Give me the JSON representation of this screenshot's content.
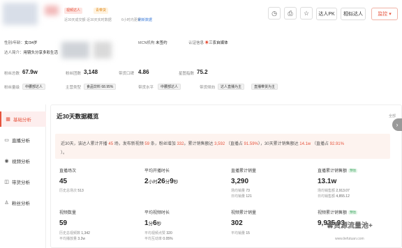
{
  "header": {
    "badge_primary": "视频达人",
    "badge_secondary": "青带货",
    "sub_left": "近30天成交额·近30天实时数据",
    "sub_time": "6小时内更新",
    "sub_link": "刷新数据",
    "pk_label": "达人PK",
    "similar_label": "相似达人",
    "monitor_label": "监控"
  },
  "profile": {
    "gender_label": "性别/年龄：",
    "gender_value": "女/34岁",
    "intro_label": "达人简介：",
    "intro_value": "用镜头分享多彩生活",
    "mcn_label": "MCN机构",
    "mcn_value": "未签约",
    "cert_label": "认证信息",
    "cert_value": "三农自媒体"
  },
  "stats": [
    {
      "label": "粉丝总数",
      "value": "67.9w"
    },
    {
      "label": "粉丝团数",
      "value": "3,148"
    },
    {
      "label": "带货口碑",
      "value": "4.86"
    },
    {
      "label": "星图指数",
      "value": "75.2"
    }
  ],
  "row_tags": {
    "fans_level_label": "粉丝量级",
    "fans_level": "中腰部达人",
    "cat_label": "主营类型",
    "cat_value": "食品饮料",
    "cat_pct": "68.95%",
    "sell_level_label": "带货水平",
    "sell_level": "中腰部达人",
    "method_label": "带货倾向",
    "method_1": "达人直播为主",
    "method_2": "直播带货为主"
  },
  "sidebar": {
    "items": [
      {
        "label": "基础分析",
        "icon": "grid-icon"
      },
      {
        "label": "直播分析",
        "icon": "tv-icon"
      },
      {
        "label": "视频分析",
        "icon": "play-icon"
      },
      {
        "label": "带货分析",
        "icon": "cart-icon"
      },
      {
        "label": "粉丝分析",
        "icon": "user-icon"
      }
    ]
  },
  "overview": {
    "title": "近30天数据概览",
    "more": "全部",
    "summary": {
      "p1": "近30天，该达人累计开播",
      "n_live": "45",
      "p2": "场，发布新视频",
      "n_video": "59",
      "p3": "条，粉丝增加",
      "n_fans": "332",
      "p4": "。累计销售额达",
      "n_sales": "3,592",
      "p5": "（直播占",
      "pct_live": "91.59%",
      "p6": "），30天累计销售额达",
      "n_total": "14.1w",
      "p7": "（直播占",
      "pct_total": "92.91%",
      "p8": "）。"
    },
    "metrics": [
      {
        "label": "直播场次",
        "value": "45",
        "subs": [
          {
            "k": "历史总场次",
            "v": "513"
          }
        ]
      },
      {
        "label": "平均开播时长",
        "value_h": "2",
        "unit_h": "小时",
        "value_m": "26",
        "unit_m": "分",
        "value_s": "9",
        "unit_s": "秒"
      },
      {
        "label": "直播累计销量",
        "value": "3,290",
        "subs": [
          {
            "k": "场均销量",
            "v": "73"
          },
          {
            "k": "日均销量",
            "v": "121"
          }
        ]
      },
      {
        "label": "直播累计销售额",
        "badge": "预估",
        "value": "13.1w",
        "subs": [
          {
            "k": "场均销售额",
            "v": "2,913.07"
          },
          {
            "k": "日均销售额",
            "v": "4,855.12"
          }
        ]
      },
      {
        "label": "视频数量",
        "value": "59",
        "subs": [
          {
            "k": "历史总视频数",
            "v": "1,342"
          },
          {
            "k": "平均播放量",
            "v": "3.2w"
          }
        ]
      },
      {
        "label": "平均视频时长",
        "value_m": "1",
        "unit_m": "分",
        "value_s": "6",
        "unit_s": "秒",
        "subs": [
          {
            "k": "平均视频点赞",
            "v": "320"
          },
          {
            "k": "平均互动率",
            "v": "0.05%"
          }
        ]
      },
      {
        "label": "视频累计销量",
        "value": "302",
        "subs": [
          {
            "k": "平均销量",
            "v": "15"
          }
        ]
      },
      {
        "label": "视频累计销售额",
        "badge": "预估",
        "value": "9,935.93",
        "subs": []
      }
    ]
  },
  "watermark": {
    "text": "资源流量池+",
    "url": "www.liefutuan.com"
  },
  "colors": {
    "accent": "#e6533c",
    "badge_green": "#35a35a",
    "summary_bg": "#fdf3ef"
  }
}
